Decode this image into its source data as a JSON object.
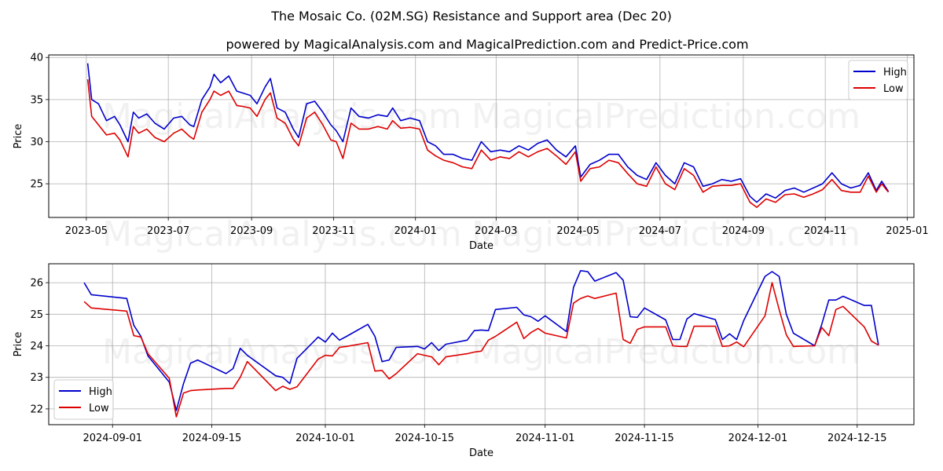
{
  "title": "The Mosaic Co. (02M.SG) Resistance and Support area (Dec 20)",
  "subtitle": "powered by MagicalAnalysis.com and MagicalPrediction.com and Predict-Price.com",
  "watermarks": [
    "MagicalAnalysis.com",
    "MagicalPrediction.com"
  ],
  "colors": {
    "high": "#0000cc",
    "low": "#dd0000",
    "grid": "#b0b0b0"
  },
  "chart_data": [
    {
      "type": "line",
      "title": "",
      "xlabel": "Date",
      "ylabel": "Price",
      "ylim": [
        21,
        40.3
      ],
      "xlim": [
        "2023-04-03",
        "2025-01-06"
      ],
      "yticks": [
        25,
        30,
        35,
        40
      ],
      "xticks": [
        "2023-05",
        "2023-07",
        "2023-09",
        "2023-11",
        "2024-01",
        "2024-03",
        "2024-05",
        "2024-07",
        "2024-09",
        "2024-11",
        "2025-01"
      ],
      "xtick_dates": [
        "2023-05-01",
        "2023-07-01",
        "2023-09-01",
        "2023-11-01",
        "2024-01-01",
        "2024-03-01",
        "2024-05-01",
        "2024-07-01",
        "2024-09-01",
        "2024-11-01",
        "2025-01-01"
      ],
      "grid": true,
      "legend": {
        "position": "top-right",
        "entries": [
          "High",
          "Low"
        ]
      },
      "x": [
        "2023-05-02",
        "2023-05-05",
        "2023-05-10",
        "2023-05-16",
        "2023-05-22",
        "2023-05-26",
        "2023-06-01",
        "2023-06-05",
        "2023-06-09",
        "2023-06-15",
        "2023-06-21",
        "2023-06-28",
        "2023-07-05",
        "2023-07-11",
        "2023-07-17",
        "2023-07-20",
        "2023-07-26",
        "2023-08-01",
        "2023-08-04",
        "2023-08-09",
        "2023-08-15",
        "2023-08-21",
        "2023-08-25",
        "2023-08-31",
        "2023-09-05",
        "2023-09-11",
        "2023-09-15",
        "2023-09-20",
        "2023-09-26",
        "2023-10-02",
        "2023-10-06",
        "2023-10-12",
        "2023-10-18",
        "2023-10-24",
        "2023-10-30",
        "2023-11-03",
        "2023-11-08",
        "2023-11-14",
        "2023-11-20",
        "2023-11-27",
        "2023-12-04",
        "2023-12-11",
        "2023-12-15",
        "2023-12-21",
        "2023-12-28",
        "2024-01-04",
        "2024-01-10",
        "2024-01-16",
        "2024-01-22",
        "2024-01-29",
        "2024-02-05",
        "2024-02-12",
        "2024-02-19",
        "2024-02-26",
        "2024-03-04",
        "2024-03-11",
        "2024-03-18",
        "2024-03-25",
        "2024-04-01",
        "2024-04-08",
        "2024-04-15",
        "2024-04-22",
        "2024-04-29",
        "2024-05-03",
        "2024-05-10",
        "2024-05-17",
        "2024-05-24",
        "2024-05-31",
        "2024-06-07",
        "2024-06-14",
        "2024-06-21",
        "2024-06-28",
        "2024-07-05",
        "2024-07-12",
        "2024-07-19",
        "2024-07-26",
        "2024-08-02",
        "2024-08-09",
        "2024-08-16",
        "2024-08-23",
        "2024-08-30",
        "2024-09-06",
        "2024-09-11",
        "2024-09-18",
        "2024-09-25",
        "2024-10-02",
        "2024-10-09",
        "2024-10-16",
        "2024-10-23",
        "2024-10-30",
        "2024-11-06",
        "2024-11-13",
        "2024-11-20",
        "2024-11-27",
        "2024-12-03",
        "2024-12-09",
        "2024-12-13",
        "2024-12-18"
      ],
      "series": [
        {
          "name": "High",
          "values": [
            39.3,
            35.0,
            34.5,
            32.5,
            33.0,
            32.0,
            30.0,
            33.5,
            32.8,
            33.3,
            32.2,
            31.5,
            32.8,
            33.0,
            32.0,
            31.8,
            35.0,
            36.5,
            38.0,
            37.0,
            37.8,
            36.0,
            35.8,
            35.5,
            34.5,
            36.5,
            37.5,
            34.0,
            33.5,
            31.5,
            30.5,
            34.5,
            34.8,
            33.5,
            32.0,
            31.3,
            30.0,
            34.0,
            33.0,
            32.8,
            33.2,
            33.0,
            34.0,
            32.5,
            32.8,
            32.5,
            30.0,
            29.5,
            28.5,
            28.5,
            28.0,
            27.8,
            30.0,
            28.8,
            29.0,
            28.8,
            29.5,
            29.0,
            29.8,
            30.2,
            29.0,
            28.2,
            29.5,
            25.8,
            27.3,
            27.8,
            28.5,
            28.5,
            27.0,
            26.0,
            25.5,
            27.5,
            26.0,
            25.0,
            27.5,
            27.0,
            24.7,
            25.0,
            25.5,
            25.3,
            25.6,
            23.5,
            22.8,
            23.8,
            23.3,
            24.2,
            24.5,
            24.0,
            24.5,
            25.0,
            26.3,
            25.0,
            24.5,
            24.8,
            26.3,
            24.2,
            25.3,
            24.1
          ]
        },
        {
          "name": "Low",
          "values": [
            37.4,
            33.0,
            32.0,
            30.8,
            31.0,
            30.2,
            28.2,
            31.8,
            31.0,
            31.5,
            30.5,
            30.0,
            31.0,
            31.5,
            30.6,
            30.3,
            33.5,
            35.0,
            36.0,
            35.5,
            36.0,
            34.3,
            34.2,
            34.0,
            33.0,
            35.0,
            35.8,
            32.8,
            32.2,
            30.3,
            29.5,
            32.8,
            33.5,
            32.0,
            30.2,
            30.0,
            28.0,
            32.2,
            31.5,
            31.5,
            31.8,
            31.5,
            32.5,
            31.6,
            31.7,
            31.5,
            29.0,
            28.3,
            27.8,
            27.5,
            27.0,
            26.8,
            29.0,
            27.8,
            28.2,
            28.0,
            28.8,
            28.2,
            28.8,
            29.2,
            28.3,
            27.3,
            28.8,
            25.3,
            26.8,
            27.0,
            27.8,
            27.5,
            26.2,
            25.0,
            24.7,
            27.0,
            25.0,
            24.3,
            26.8,
            26.0,
            24.0,
            24.7,
            24.8,
            24.8,
            25.0,
            22.8,
            22.2,
            23.2,
            22.8,
            23.7,
            23.8,
            23.4,
            23.8,
            24.3,
            25.5,
            24.2,
            24.0,
            24.0,
            25.9,
            24.0,
            25.0,
            24.0
          ]
        }
      ]
    },
    {
      "type": "line",
      "title": "",
      "xlabel": "Date",
      "ylabel": "Price",
      "ylim": [
        21.5,
        26.6
      ],
      "xlim": [
        "2024-08-23",
        "2024-12-23"
      ],
      "yticks": [
        22,
        23,
        24,
        25,
        26
      ],
      "xticks": [
        "2024-09-01",
        "2024-09-15",
        "2024-10-01",
        "2024-10-15",
        "2024-11-01",
        "2024-11-15",
        "2024-12-01",
        "2024-12-15"
      ],
      "grid": true,
      "legend": {
        "position": "bottom-left",
        "entries": [
          "High",
          "Low"
        ]
      },
      "x": [
        "2024-08-28",
        "2024-08-29",
        "2024-09-03",
        "2024-09-04",
        "2024-09-05",
        "2024-09-06",
        "2024-09-09",
        "2024-09-10",
        "2024-09-11",
        "2024-09-12",
        "2024-09-13",
        "2024-09-17",
        "2024-09-18",
        "2024-09-19",
        "2024-09-20",
        "2024-09-24",
        "2024-09-25",
        "2024-09-26",
        "2024-09-27",
        "2024-09-30",
        "2024-10-01",
        "2024-10-02",
        "2024-10-03",
        "2024-10-04",
        "2024-10-07",
        "2024-10-08",
        "2024-10-09",
        "2024-10-10",
        "2024-10-11",
        "2024-10-14",
        "2024-10-15",
        "2024-10-16",
        "2024-10-17",
        "2024-10-18",
        "2024-10-21",
        "2024-10-22",
        "2024-10-23",
        "2024-10-24",
        "2024-10-25",
        "2024-10-28",
        "2024-10-29",
        "2024-10-30",
        "2024-10-31",
        "2024-11-01",
        "2024-11-04",
        "2024-11-05",
        "2024-11-06",
        "2024-11-07",
        "2024-11-08",
        "2024-11-11",
        "2024-11-12",
        "2024-11-13",
        "2024-11-14",
        "2024-11-15",
        "2024-11-18",
        "2024-11-19",
        "2024-11-20",
        "2024-11-21",
        "2024-11-22",
        "2024-11-25",
        "2024-11-26",
        "2024-11-27",
        "2024-11-28",
        "2024-11-29",
        "2024-12-02",
        "2024-12-03",
        "2024-12-04",
        "2024-12-05",
        "2024-12-06",
        "2024-12-09",
        "2024-12-10",
        "2024-12-11",
        "2024-12-12",
        "2024-12-13",
        "2024-12-16",
        "2024-12-17",
        "2024-12-18"
      ],
      "series": [
        {
          "name": "High",
          "values": [
            26.0,
            25.62,
            25.5,
            24.65,
            24.3,
            23.68,
            22.85,
            21.95,
            22.8,
            23.45,
            23.55,
            23.12,
            23.28,
            23.92,
            23.7,
            23.05,
            23.0,
            22.8,
            23.6,
            24.28,
            24.12,
            24.4,
            24.18,
            24.3,
            24.68,
            24.3,
            23.5,
            23.55,
            23.95,
            23.98,
            23.9,
            24.1,
            23.85,
            24.05,
            24.18,
            24.48,
            24.5,
            24.48,
            25.15,
            25.22,
            24.98,
            24.92,
            24.78,
            24.95,
            24.45,
            25.85,
            26.38,
            26.35,
            26.05,
            26.32,
            26.08,
            24.92,
            24.9,
            25.2,
            24.82,
            24.2,
            24.2,
            24.85,
            25.02,
            24.83,
            24.2,
            24.38,
            24.2,
            24.8,
            26.2,
            26.35,
            26.2,
            25.0,
            24.4,
            24.0,
            24.68,
            25.45,
            25.45,
            25.57,
            25.28,
            25.28,
            24.02
          ]
        },
        {
          "name": "Low",
          "values": [
            25.4,
            25.2,
            25.1,
            24.32,
            24.28,
            23.75,
            22.97,
            21.75,
            22.5,
            22.58,
            22.6,
            22.65,
            22.65,
            23.0,
            23.5,
            22.58,
            22.72,
            22.62,
            22.7,
            23.58,
            23.7,
            23.68,
            23.95,
            23.98,
            24.1,
            23.2,
            23.22,
            22.95,
            23.12,
            23.75,
            23.7,
            23.65,
            23.4,
            23.65,
            23.75,
            23.8,
            23.83,
            24.18,
            24.3,
            24.75,
            24.23,
            24.42,
            24.55,
            24.4,
            24.25,
            25.35,
            25.5,
            25.58,
            25.5,
            25.67,
            24.2,
            24.08,
            24.52,
            24.6,
            24.6,
            24.0,
            23.98,
            23.98,
            24.62,
            24.62,
            23.98,
            24.0,
            24.12,
            23.97,
            24.95,
            26.0,
            25.15,
            24.35,
            23.98,
            24.0,
            24.58,
            24.32,
            25.15,
            25.25,
            24.6,
            24.15,
            24.02
          ]
        }
      ]
    }
  ]
}
